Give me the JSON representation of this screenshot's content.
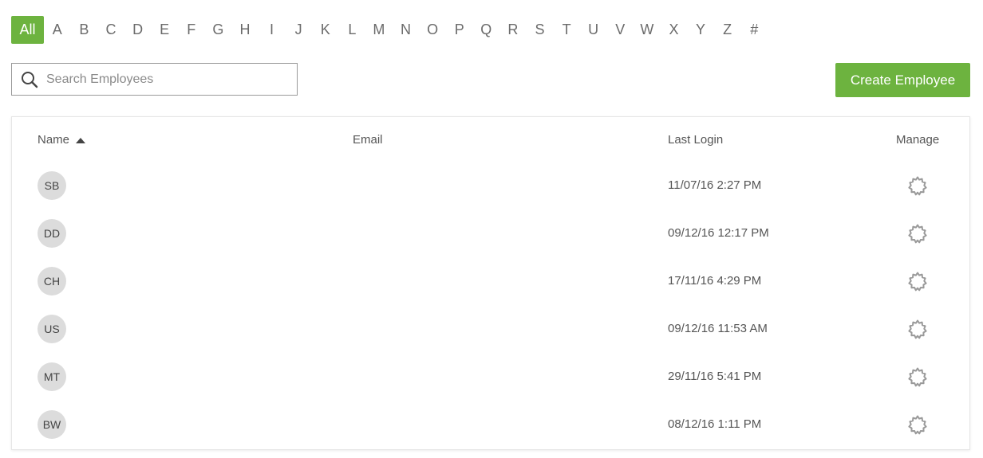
{
  "alphabet": [
    "All",
    "A",
    "B",
    "C",
    "D",
    "E",
    "F",
    "G",
    "H",
    "I",
    "J",
    "K",
    "L",
    "M",
    "N",
    "O",
    "P",
    "Q",
    "R",
    "S",
    "T",
    "U",
    "V",
    "W",
    "X",
    "Y",
    "Z",
    "#"
  ],
  "alphabet_active": "All",
  "search": {
    "placeholder": "Search Employees",
    "value": ""
  },
  "create_button": {
    "label": "Create Employee"
  },
  "accent_color": "#6db33f",
  "table": {
    "headers": {
      "name": "Name",
      "email": "Email",
      "last_login": "Last Login",
      "manage": "Manage"
    },
    "sort": {
      "column": "name",
      "direction": "ascending"
    },
    "rows": [
      {
        "initials": "SB",
        "email": "",
        "last_login": "11/07/16 2:27 PM",
        "manage_icon": "gear-icon"
      },
      {
        "initials": "DD",
        "email": "",
        "last_login": "09/12/16 12:17 PM",
        "manage_icon": "gear-icon"
      },
      {
        "initials": "CH",
        "email": "",
        "last_login": "17/11/16 4:29 PM",
        "manage_icon": "gear-icon"
      },
      {
        "initials": "US",
        "email": "",
        "last_login": "09/12/16 11:53 AM",
        "manage_icon": "gear-icon"
      },
      {
        "initials": "MT",
        "email": "",
        "last_login": "29/11/16 5:41 PM",
        "manage_icon": "gear-icon"
      },
      {
        "initials": "BW",
        "email": "",
        "last_login": "08/12/16 1:11 PM",
        "manage_icon": "gear-icon"
      }
    ]
  }
}
